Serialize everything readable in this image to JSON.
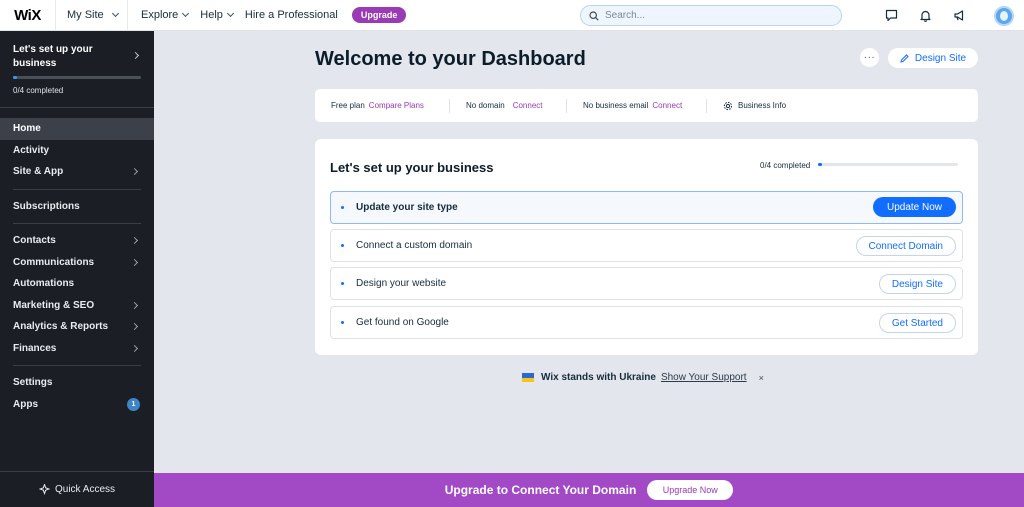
{
  "topbar": {
    "logo": "WiX",
    "site_selector": "My Site",
    "nav": [
      {
        "label": "Explore",
        "dropdown": true
      },
      {
        "label": "Help",
        "dropdown": true
      },
      {
        "label": "Hire a Professional",
        "dropdown": false
      }
    ],
    "upgrade_label": "Upgrade",
    "search_placeholder": "Search...",
    "icons": [
      "chat-icon",
      "bell-icon",
      "megaphone-icon",
      "avatar"
    ]
  },
  "sidebar": {
    "setup_title": "Let's set up your business",
    "setup_progress": 0,
    "setup_count": "0/4 completed",
    "items": [
      {
        "label": "Home",
        "active": true,
        "arrow": false
      },
      {
        "label": "Activity",
        "arrow": false
      },
      {
        "label": "Site & App",
        "arrow": true
      },
      {
        "label": "Subscriptions",
        "arrow": false
      },
      {
        "label": "Contacts",
        "arrow": true
      },
      {
        "label": "Communications",
        "arrow": true
      },
      {
        "label": "Automations",
        "arrow": false
      },
      {
        "label": "Marketing & SEO",
        "arrow": true
      },
      {
        "label": "Analytics & Reports",
        "arrow": true
      },
      {
        "label": "Finances",
        "arrow": true
      },
      {
        "label": "Settings",
        "arrow": false
      },
      {
        "label": "Apps",
        "badge": "1"
      }
    ],
    "quick_access": "Quick Access"
  },
  "main": {
    "title": "Welcome to your Dashboard",
    "more_label": "···",
    "design_site_label": "Design Site",
    "infobar": {
      "plan_text": "Free plan",
      "plan_link": "Compare Plans",
      "domain_text": "No domain",
      "domain_link": "Connect",
      "email_text": "No business email",
      "email_link": "Connect",
      "business_info": "Business Info"
    },
    "setup_card": {
      "title": "Let's set up your business",
      "progress_text": "0/4 completed",
      "progress": 0,
      "tasks": [
        {
          "label": "Update your site type",
          "button": "Update Now",
          "primary": true
        },
        {
          "label": "Connect a custom domain",
          "button": "Connect Domain",
          "primary": false
        },
        {
          "label": "Design your website",
          "button": "Design Site",
          "primary": false
        },
        {
          "label": "Get found on Google",
          "button": "Get Started",
          "primary": false
        }
      ]
    },
    "ukraine": {
      "text": "Wix stands with Ukraine",
      "link": "Show Your Support",
      "close": "×"
    }
  },
  "banner": {
    "text": "Upgrade to Connect Your Domain",
    "button": "Upgrade Now"
  },
  "colors": {
    "accent": "#116dff",
    "purple": "#9a3ab5",
    "sidebar_bg": "#1b1e24",
    "banner_bg": "#a24ac6"
  }
}
